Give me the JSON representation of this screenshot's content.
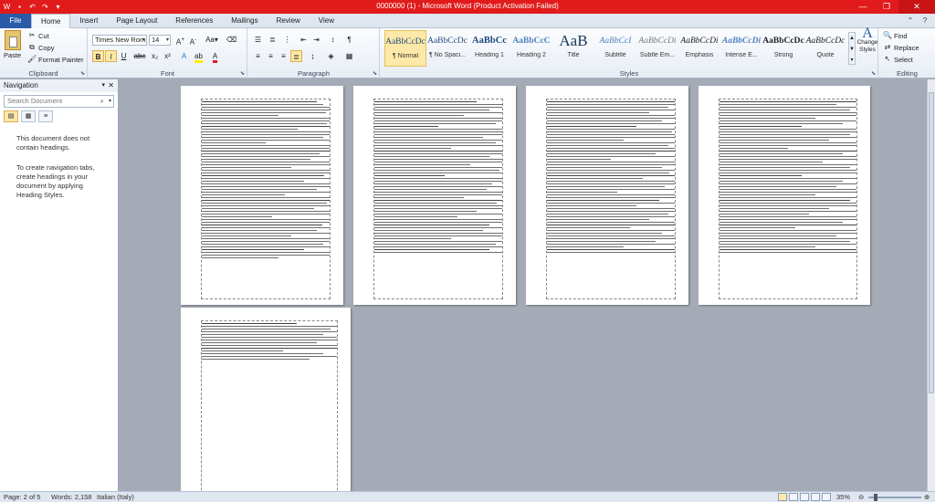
{
  "window": {
    "title": "0000000 (1) - Microsoft Word (Product Activation Failed)"
  },
  "ribbon_tabs": [
    "File",
    "Home",
    "Insert",
    "Page Layout",
    "References",
    "Mailings",
    "Review",
    "View"
  ],
  "clipboard": {
    "paste": "Paste",
    "cut": "Cut",
    "copy": "Copy",
    "format_painter": "Format Painter",
    "label": "Clipboard"
  },
  "font": {
    "name": "Times New Rom",
    "size": "14",
    "label": "Font"
  },
  "paragraph": {
    "label": "Paragraph"
  },
  "styles": {
    "label": "Styles",
    "items": [
      {
        "sample": "AaBbCcDc",
        "name": "¶ Normal"
      },
      {
        "sample": "AaBbCcDc",
        "name": "¶ No Spaci..."
      },
      {
        "sample": "AaBbCc",
        "name": "Heading 1"
      },
      {
        "sample": "AaBbCcC",
        "name": "Heading 2"
      },
      {
        "sample": "AaB",
        "name": "Title"
      },
      {
        "sample": "AaBbCcI",
        "name": "Subtitle"
      },
      {
        "sample": "AaBbCcDi",
        "name": "Subtle Em..."
      },
      {
        "sample": "AaBbCcDi",
        "name": "Emphasis"
      },
      {
        "sample": "AaBbCcDi",
        "name": "Intense E..."
      },
      {
        "sample": "AaBbCcDc",
        "name": "Strong"
      },
      {
        "sample": "AaBbCcDc",
        "name": "Quote"
      }
    ],
    "change_styles": "Change Styles"
  },
  "editing": {
    "find": "Find",
    "replace": "Replace",
    "select": "Select",
    "label": "Editing"
  },
  "navigation": {
    "title": "Navigation",
    "search_placeholder": "Search Document",
    "message1": "This document does not contain headings.",
    "message2": "To create navigation tabs, create headings in your document by applying Heading Styles."
  },
  "status": {
    "page": "Page: 2 of 5",
    "words": "Words: 2,158",
    "language": "Italian (Italy)",
    "zoom": "35%",
    "zoom_level": 0.35
  },
  "colors": {
    "titlebar": "#e11b1b",
    "file_tab": "#2a5aa8",
    "active_style": "#fde8a8"
  }
}
